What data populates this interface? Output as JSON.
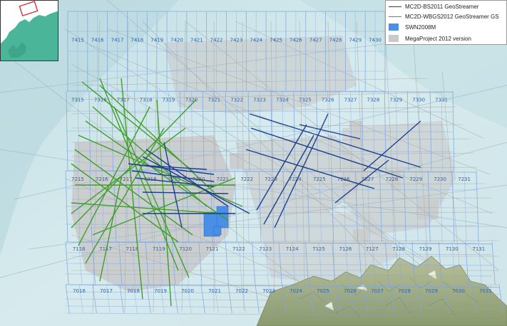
{
  "legend": {
    "items": [
      {
        "label": "MC2D-BS2011 GeoStreamer",
        "type": "line",
        "color": "#1f3f8c"
      },
      {
        "label": "MC2D-WBGS2012 GeoStreamer GS",
        "type": "line",
        "color": "#3f9f2a"
      },
      {
        "label": "SWN2008M",
        "type": "box",
        "color": "#4a8fe6"
      },
      {
        "label": "MegaProject 2012 version",
        "type": "box",
        "color": "#c9c9c9"
      }
    ]
  },
  "colors": {
    "sea": "#cfe6ea",
    "land": "#9aa87e",
    "grid": "#7fa6e0",
    "bs2011": "#1f3f8c",
    "wbgs2012": "#3f9f2a",
    "swn2008m": "#4a8fe6",
    "megaproject": "#c9c9c9",
    "inset_land": "#4bb59a",
    "inset_box": "#e0202a"
  },
  "blocks": {
    "row_74": [
      "7415",
      "7416",
      "7417",
      "7418",
      "7419",
      "7420",
      "7421",
      "7422",
      "7423",
      "7424",
      "7425",
      "7426",
      "7427",
      "7428",
      "7429",
      "7430"
    ],
    "row_73": [
      "7315",
      "7316",
      "7317",
      "7318",
      "7319",
      "7320",
      "7321",
      "7322",
      "7323",
      "7324",
      "7325",
      "7326",
      "7327",
      "7328",
      "7329",
      "7330",
      "7331"
    ],
    "row_72": [
      "7215",
      "7216",
      "7217",
      "7218",
      "7219",
      "7220",
      "7221",
      "7222",
      "7223",
      "7224",
      "7225",
      "7226",
      "7227",
      "7228",
      "7229",
      "7230",
      "7231"
    ],
    "row_71": [
      "7116",
      "7117",
      "7118",
      "7119",
      "7120",
      "7121",
      "7122",
      "7123",
      "7124",
      "7125",
      "7126",
      "7127",
      "7128",
      "7129",
      "7130",
      "7131"
    ],
    "row_70": [
      "7016",
      "7017",
      "7018",
      "7019",
      "7020",
      "7021",
      "7022",
      "7023",
      "7024",
      "7025",
      "7026",
      "7027",
      "7028",
      "7029",
      "7030",
      "7031"
    ]
  }
}
